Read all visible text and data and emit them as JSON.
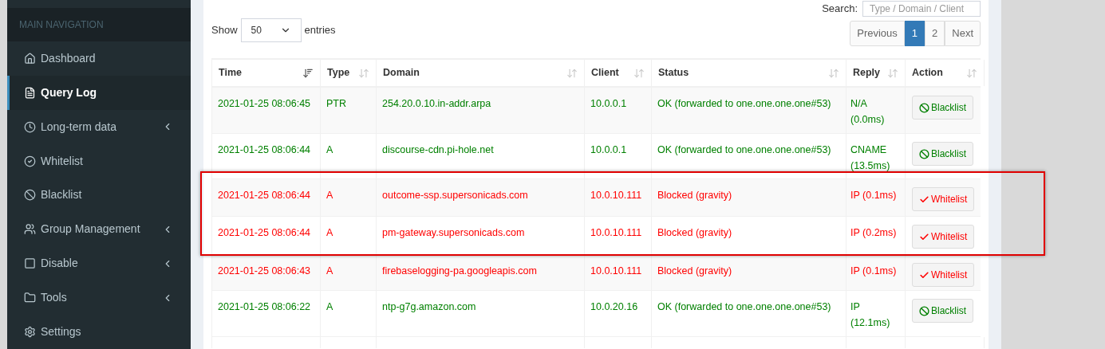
{
  "sidebar": {
    "header": "MAIN NAVIGATION",
    "items": [
      {
        "label": "Dashboard",
        "selected": false,
        "has_submenu": false
      },
      {
        "label": "Query Log",
        "selected": true,
        "has_submenu": false
      },
      {
        "label": "Long-term data",
        "selected": false,
        "has_submenu": true
      },
      {
        "label": "Whitelist",
        "selected": false,
        "has_submenu": false
      },
      {
        "label": "Blacklist",
        "selected": false,
        "has_submenu": false
      },
      {
        "label": "Group Management",
        "selected": false,
        "has_submenu": true
      },
      {
        "label": "Disable",
        "selected": false,
        "has_submenu": true
      },
      {
        "label": "Tools",
        "selected": false,
        "has_submenu": true
      },
      {
        "label": "Settings",
        "selected": false,
        "has_submenu": false
      }
    ]
  },
  "controls": {
    "show_label": "Show",
    "page_size": "50",
    "entries_label": "entries",
    "search_label": "Search:",
    "search_placeholder": "Type / Domain / Client"
  },
  "pagination": [
    {
      "label": "Previous",
      "selected": false
    },
    {
      "label": "1",
      "selected": true
    },
    {
      "label": "2",
      "selected": false
    },
    {
      "label": "Next",
      "selected": false
    }
  ],
  "table": {
    "columns": [
      {
        "label": "Time",
        "sorted": true
      },
      {
        "label": "Type",
        "sorted": false
      },
      {
        "label": "Domain",
        "sorted": false
      },
      {
        "label": "Client",
        "sorted": false
      },
      {
        "label": "Status",
        "sorted": false
      },
      {
        "label": "Reply",
        "sorted": false
      },
      {
        "label": "Action",
        "sorted": false
      }
    ],
    "rows": [
      {
        "time": "2021-01-25 08:06:45",
        "type": "PTR",
        "domain": "254.20.0.10.in-addr.arpa",
        "client": "10.0.0.1",
        "status": "OK (forwarded to one.one.one.one#53)",
        "reply": "N/A (0.0ms)",
        "blocked": false,
        "action": "Blacklist"
      },
      {
        "time": "2021-01-25 08:06:44",
        "type": "A",
        "domain": "discourse-cdn.pi-hole.net",
        "client": "10.0.0.1",
        "status": "OK (forwarded to one.one.one.one#53)",
        "reply": "CNAME (13.5ms)",
        "blocked": false,
        "action": "Blacklist"
      },
      {
        "time": "2021-01-25 08:06:44",
        "type": "A",
        "domain": "outcome-ssp.supersonicads.com",
        "client": "10.0.10.111",
        "status": "Blocked (gravity)",
        "reply": "IP (0.1ms)",
        "blocked": true,
        "action": "Whitelist"
      },
      {
        "time": "2021-01-25 08:06:44",
        "type": "A",
        "domain": "pm-gateway.supersonicads.com",
        "client": "10.0.10.111",
        "status": "Blocked (gravity)",
        "reply": "IP (0.2ms)",
        "blocked": true,
        "action": "Whitelist"
      },
      {
        "time": "2021-01-25 08:06:43",
        "type": "A",
        "domain": "firebaselogging-pa.googleapis.com",
        "client": "10.0.10.111",
        "status": "Blocked (gravity)",
        "reply": "IP (0.1ms)",
        "blocked": true,
        "action": "Whitelist"
      },
      {
        "time": "2021-01-25 08:06:22",
        "type": "A",
        "domain": "ntp-g7g.amazon.com",
        "client": "10.0.20.16",
        "status": "OK (forwarded to one.one.one.one#53)",
        "reply": "IP (12.1ms)",
        "blocked": false,
        "action": "Blacklist"
      }
    ]
  }
}
